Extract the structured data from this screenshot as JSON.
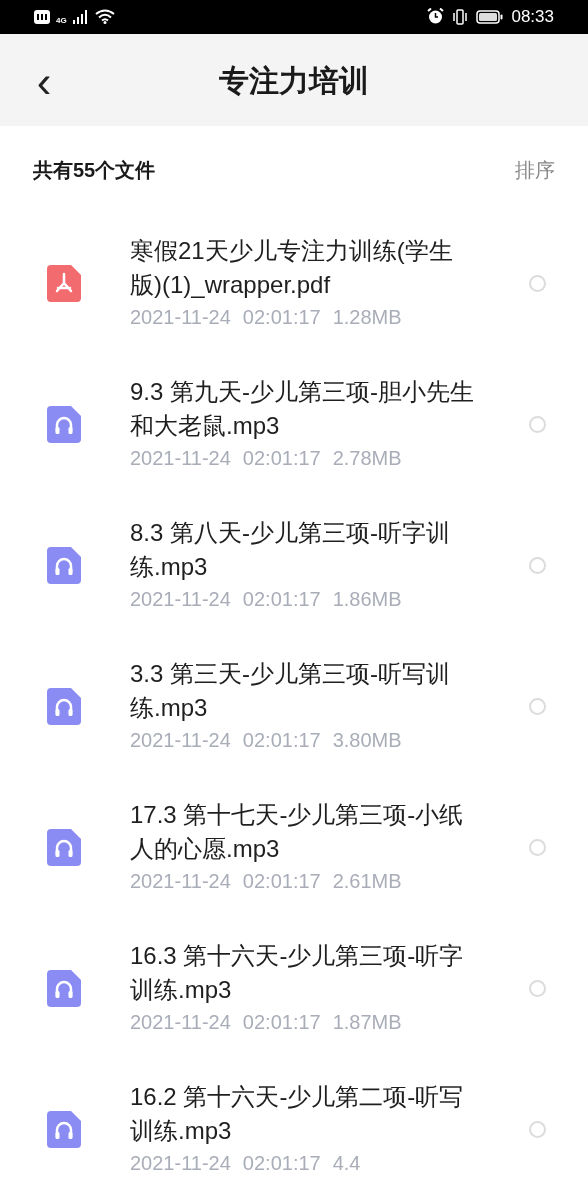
{
  "status_bar": {
    "time": "08:33",
    "signal_label": "4G"
  },
  "header": {
    "back": "‹",
    "title": "专注力培训"
  },
  "summary": {
    "count_text": "共有55个文件",
    "sort": "排序"
  },
  "files": [
    {
      "kind": "pdf",
      "name": "寒假21天少儿专注力训练(学生版)(1)_wrapper.pdf",
      "date": "2021-11-24",
      "time": "02:01:17",
      "size": "1.28MB",
      "selected": false
    },
    {
      "kind": "audio",
      "name": "9.3 第九天-少儿第三项-胆小先生和大老鼠.mp3",
      "date": "2021-11-24",
      "time": "02:01:17",
      "size": "2.78MB",
      "selected": false
    },
    {
      "kind": "audio",
      "name": "8.3 第八天-少儿第三项-听字训练.mp3",
      "date": "2021-11-24",
      "time": "02:01:17",
      "size": "1.86MB",
      "selected": false
    },
    {
      "kind": "audio",
      "name": "3.3 第三天-少儿第三项-听写训练.mp3",
      "date": "2021-11-24",
      "time": "02:01:17",
      "size": "3.80MB",
      "selected": false
    },
    {
      "kind": "audio",
      "name": "17.3 第十七天-少儿第三项-小纸人的心愿.mp3",
      "date": "2021-11-24",
      "time": "02:01:17",
      "size": "2.61MB",
      "selected": false
    },
    {
      "kind": "audio",
      "name": "16.3 第十六天-少儿第三项-听字训练.mp3",
      "date": "2021-11-24",
      "time": "02:01:17",
      "size": "1.87MB",
      "selected": false
    },
    {
      "kind": "audio",
      "name": "16.2 第十六天-少儿第二项-听写训练.mp3",
      "date": "2021-11-24",
      "time": "02:01:17",
      "size": "4.4",
      "selected": false
    }
  ]
}
